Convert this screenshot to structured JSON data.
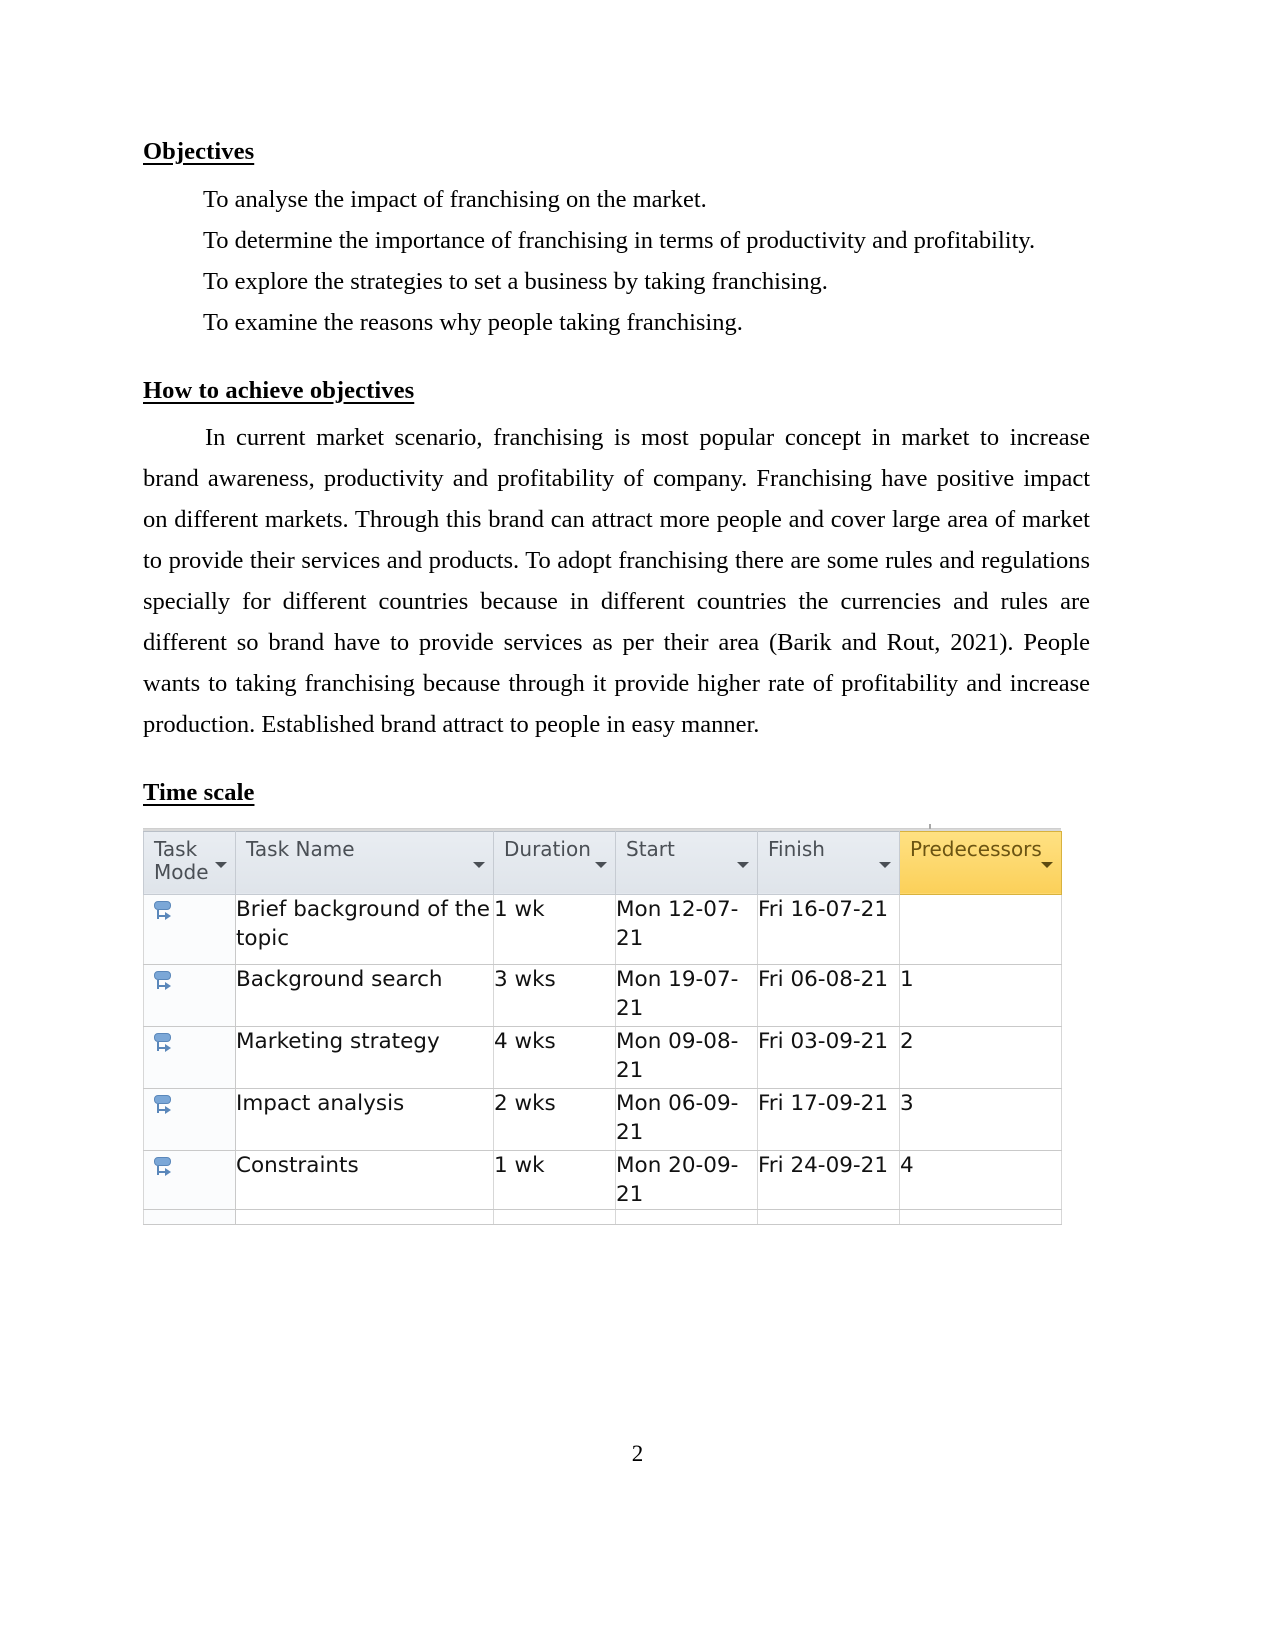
{
  "document": {
    "sections": {
      "objectives": {
        "heading": "Objectives",
        "items": [
          "To analyse the impact of franchising on the market.",
          "To determine the importance of franchising in terms of productivity and profitability.",
          "To explore the strategies to set a business by taking franchising.",
          "To examine the reasons why people taking franchising."
        ]
      },
      "how_to_achieve": {
        "heading": "How to achieve objectives",
        "paragraph": "In current market scenario, franchising is most popular concept in market to increase brand awareness, productivity and profitability of company. Franchising have positive impact on different markets. Through this brand can attract more people and cover large area of market to provide their services and products. To adopt franchising there are some rules and regulations specially for different countries because in different countries the currencies and rules are different so brand have to provide services as per their area (Barik and Rout, 2021). People wants to taking franchising because through it provide higher rate of profitability and increase production. Established brand  attract to people in easy manner."
      },
      "time_scale": {
        "heading": "Time scale"
      }
    },
    "page_number": "2"
  },
  "project_table": {
    "columns": [
      {
        "label": "Task Mode",
        "filter_icon": "chevron-down-icon",
        "highlighted": false
      },
      {
        "label": "Task Name",
        "filter_icon": "chevron-down-icon",
        "highlighted": false
      },
      {
        "label": "Duration",
        "filter_icon": "chevron-down-icon",
        "highlighted": false
      },
      {
        "label": "Start",
        "filter_icon": "chevron-down-icon",
        "highlighted": false
      },
      {
        "label": "Finish",
        "filter_icon": "chevron-down-icon",
        "highlighted": false
      },
      {
        "label": "Predecessors",
        "filter_icon": "chevron-down-icon",
        "highlighted": true
      }
    ],
    "header_colors": {
      "default_background": "#dfe4ea",
      "default_text": "#4a4f55",
      "highlight_background": "#fcd968",
      "highlight_text": "#6b5412"
    },
    "task_mode_icon": "auto-schedule-icon",
    "rows": [
      {
        "task_name": "Brief background of the topic",
        "duration": "1 wk",
        "start": "Mon 12-07-21",
        "finish": "Fri 16-07-21",
        "predecessors": ""
      },
      {
        "task_name": "Background search",
        "duration": "3 wks",
        "start": "Mon 19-07-21",
        "finish": "Fri 06-08-21",
        "predecessors": "1"
      },
      {
        "task_name": "Marketing strategy",
        "duration": "4 wks",
        "start": "Mon 09-08-21",
        "finish": "Fri 03-09-21",
        "predecessors": "2"
      },
      {
        "task_name": "Impact analysis",
        "duration": "2 wks",
        "start": "Mon 06-09-21",
        "finish": "Fri 17-09-21",
        "predecessors": "3"
      },
      {
        "task_name": "Constraints",
        "duration": "1 wk",
        "start": "Mon 20-09-21",
        "finish": "Fri 24-09-21",
        "predecessors": "4"
      }
    ]
  }
}
